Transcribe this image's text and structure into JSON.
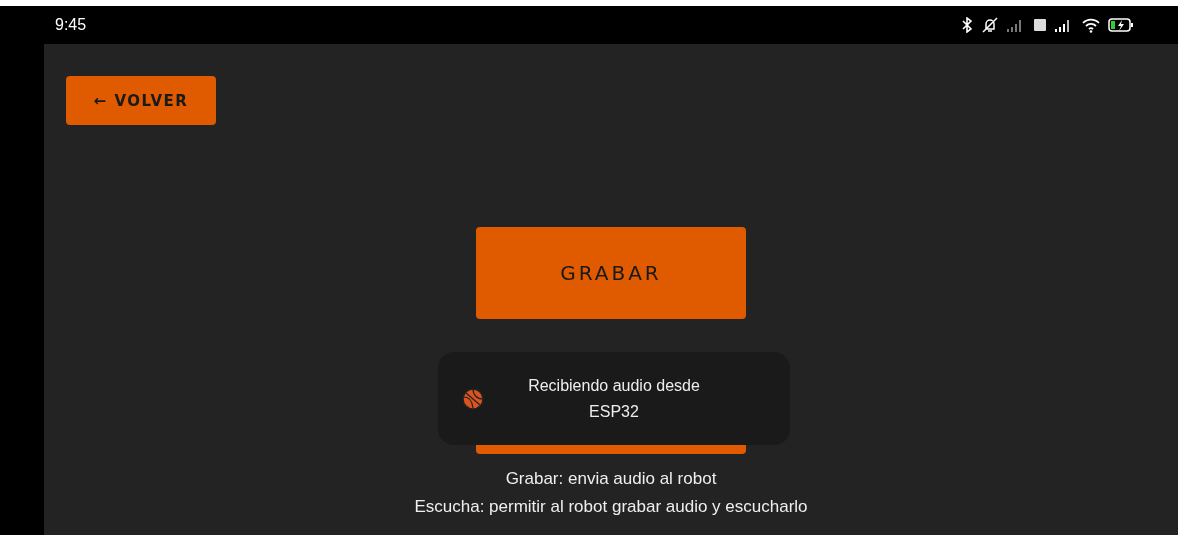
{
  "status_bar": {
    "time": "9:45"
  },
  "back_button": {
    "label": "← VOLVER"
  },
  "buttons": [
    {
      "kind": "labeled",
      "label": "GRABAR"
    },
    {
      "kind": "covered"
    }
  ],
  "toast": {
    "message": "Recibiendo audio desde ESP32"
  },
  "help_lines": [
    "Grabar: envia audio al robot",
    "Escucha: permitir al robot grabar audio y escucharlo"
  ]
}
